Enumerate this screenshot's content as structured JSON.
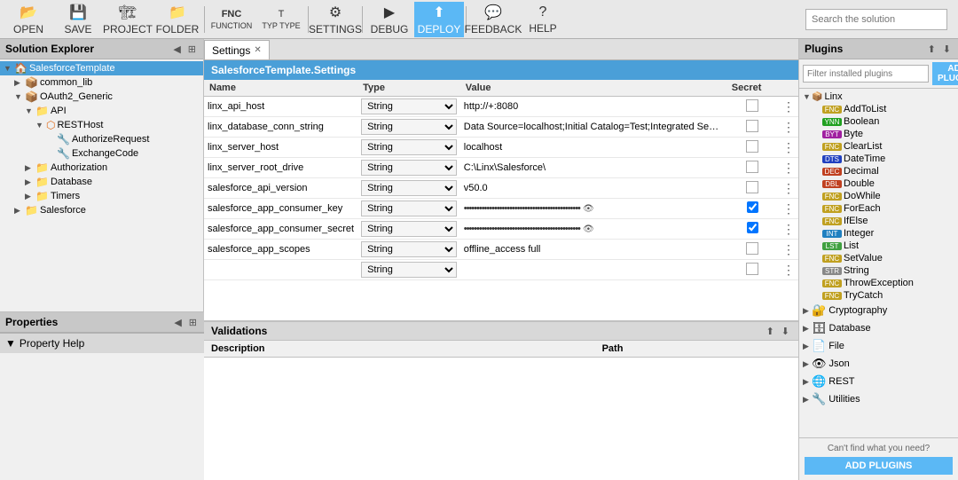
{
  "toolbar": {
    "buttons": [
      {
        "id": "open",
        "label": "OPEN",
        "icon": "📂"
      },
      {
        "id": "save",
        "label": "SAVE",
        "icon": "💾"
      },
      {
        "id": "project",
        "label": "PROJECT",
        "icon": "📁"
      },
      {
        "id": "folder",
        "label": "FOLDER",
        "icon": "📁"
      },
      {
        "id": "function",
        "label": "FUNCTION",
        "icon": "FNC"
      },
      {
        "id": "typ",
        "label": "TYP TYPE",
        "icon": "T"
      },
      {
        "id": "settings",
        "label": "SETTINGS",
        "icon": "⚙"
      },
      {
        "id": "debug",
        "label": "DEBUG",
        "icon": "▶"
      },
      {
        "id": "deploy",
        "label": "DEPLOY",
        "icon": "↑"
      },
      {
        "id": "feedback",
        "label": "FEEDBACK",
        "icon": "💬"
      },
      {
        "id": "help",
        "label": "HELP",
        "icon": "?"
      }
    ],
    "search_placeholder": "Search the solution"
  },
  "solution_explorer": {
    "title": "Solution Explorer",
    "items": [
      {
        "id": "salesforce-template",
        "label": "SalesforceTemplate",
        "level": 0,
        "icon": "🏠",
        "expanded": true,
        "type": "root"
      },
      {
        "id": "common-lib",
        "label": "common_lib",
        "level": 1,
        "icon": "📦",
        "expanded": false,
        "type": "folder"
      },
      {
        "id": "oauth2-generic",
        "label": "OAuth2_Generic",
        "level": 1,
        "icon": "📦",
        "expanded": true,
        "type": "folder"
      },
      {
        "id": "api",
        "label": "API",
        "level": 2,
        "icon": "📁",
        "expanded": true,
        "type": "folder"
      },
      {
        "id": "resthost",
        "label": "RESTHost",
        "level": 3,
        "icon": "🔌",
        "expanded": true,
        "type": "item"
      },
      {
        "id": "authorize-request",
        "label": "AuthorizeRequest",
        "level": 4,
        "icon": "🔧",
        "expanded": false,
        "type": "item"
      },
      {
        "id": "exchange-code",
        "label": "ExchangeCode",
        "level": 4,
        "icon": "🔧",
        "expanded": false,
        "type": "item"
      },
      {
        "id": "authorization",
        "label": "Authorization",
        "level": 2,
        "icon": "📁",
        "expanded": false,
        "type": "folder"
      },
      {
        "id": "database",
        "label": "Database",
        "level": 2,
        "icon": "📁",
        "expanded": false,
        "type": "folder"
      },
      {
        "id": "timers",
        "label": "Timers",
        "level": 2,
        "icon": "📁",
        "expanded": false,
        "type": "folder"
      },
      {
        "id": "salesforce",
        "label": "Salesforce",
        "level": 1,
        "icon": "📁",
        "expanded": false,
        "type": "folder"
      }
    ]
  },
  "settings_tab": {
    "label": "Settings",
    "title": "SalesforceTemplate.Settings",
    "columns": {
      "name": "Name",
      "type": "Type",
      "value": "Value",
      "secret": "Secret"
    },
    "rows": [
      {
        "name": "linx_api_host",
        "type": "String",
        "value": "http://+:8080",
        "secret": false,
        "masked": false
      },
      {
        "name": "linx_database_conn_string",
        "type": "String",
        "value": "Data Source=localhost;Initial Catalog=Test;Integrated Security",
        "secret": false,
        "masked": false
      },
      {
        "name": "linx_server_host",
        "type": "String",
        "value": "localhost",
        "secret": false,
        "masked": false
      },
      {
        "name": "linx_server_root_drive",
        "type": "String",
        "value": "C:\\Linx\\Salesforce\\",
        "secret": false,
        "masked": false
      },
      {
        "name": "salesforce_api_version",
        "type": "String",
        "value": "v50.0",
        "secret": false,
        "masked": false
      },
      {
        "name": "salesforce_app_consumer_key",
        "type": "String",
        "value": "••••••••••••••••••••••••••••••••••••••••••••••",
        "secret": true,
        "masked": true
      },
      {
        "name": "salesforce_app_consumer_secret",
        "type": "String",
        "value": "••••••••••••••••••••••••••••••••••••••••••••••",
        "secret": true,
        "masked": true
      },
      {
        "name": "salesforce_app_scopes",
        "type": "String",
        "value": "offline_access full",
        "secret": false,
        "masked": false
      },
      {
        "name": "",
        "type": "String",
        "value": "",
        "secret": false,
        "masked": false
      }
    ]
  },
  "validations": {
    "title": "Validations",
    "columns": {
      "description": "Description",
      "path": "Path"
    },
    "rows": []
  },
  "plugins": {
    "title": "Plugins",
    "filter_placeholder": "Filter installed plugins",
    "add_button": "ADD PLUGINS",
    "linx_section": {
      "label": "Linx",
      "items": [
        {
          "badge": "FNC",
          "badge_class": "badge-fnc",
          "label": "AddToList"
        },
        {
          "badge": "YNN",
          "badge_class": "badge-ynn",
          "label": "Boolean"
        },
        {
          "badge": "BYT",
          "badge_class": "badge-byt",
          "label": "Byte"
        },
        {
          "badge": "FNC",
          "badge_class": "badge-fnc",
          "label": "ClearList"
        },
        {
          "badge": "DTS",
          "badge_class": "badge-dts",
          "label": "DateTime"
        },
        {
          "badge": "DEC",
          "badge_class": "badge-dec",
          "label": "Decimal"
        },
        {
          "badge": "DBL",
          "badge_class": "badge-dbl",
          "label": "Double"
        },
        {
          "badge": "FNC",
          "badge_class": "badge-fnc",
          "label": "DoWhile"
        },
        {
          "badge": "FNC",
          "badge_class": "badge-fnc",
          "label": "ForEach"
        },
        {
          "badge": "FNC",
          "badge_class": "badge-fnc",
          "label": "IfElse"
        },
        {
          "badge": "INT",
          "badge_class": "badge-int",
          "label": "Integer"
        },
        {
          "badge": "LST",
          "badge_class": "badge-lst",
          "label": "List"
        },
        {
          "badge": "FNC",
          "badge_class": "badge-fnc",
          "label": "SetValue"
        },
        {
          "badge": "STR",
          "badge_class": "badge-str",
          "label": "String"
        },
        {
          "badge": "FNC",
          "badge_class": "badge-fnc",
          "label": "ThrowException"
        },
        {
          "badge": "FNC",
          "badge_class": "badge-fnc",
          "label": "TryCatch"
        }
      ]
    },
    "categories": [
      {
        "icon": "🔐",
        "label": "Cryptography"
      },
      {
        "icon": "🗄",
        "label": "Database"
      },
      {
        "icon": "📄",
        "label": "File"
      },
      {
        "icon": "👁",
        "label": "Json"
      },
      {
        "icon": "🌐",
        "label": "REST"
      },
      {
        "icon": "🔧",
        "label": "Utilities"
      }
    ],
    "footer_text": "Can't find what you need?",
    "footer_button": "ADD PLUGINS"
  },
  "properties": {
    "title": "Properties"
  },
  "property_help": {
    "label": "Property Help"
  }
}
